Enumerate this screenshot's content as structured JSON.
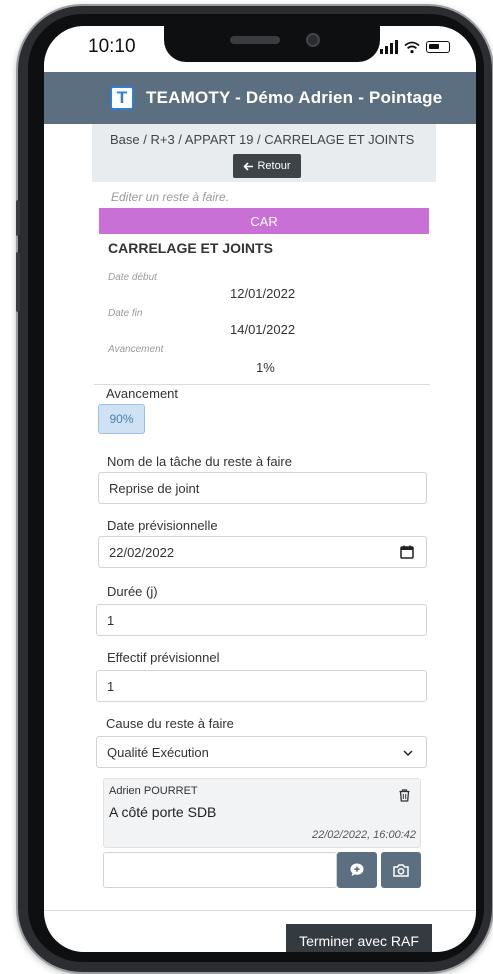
{
  "status_bar": {
    "time": "10:10"
  },
  "header": {
    "logo_letter": "T",
    "title": "TEAMOTY - Démo Adrien - Pointage",
    "bg_color": "#5c6f80"
  },
  "breadcrumb": {
    "path": "Base / R+3 / APPART 19 / CARRELAGE ET JOINTS",
    "back_label": "Retour",
    "back_icon": "arrow-left-icon"
  },
  "edit_caption": "Editer un reste à faire.",
  "task": {
    "category": "CAR",
    "category_color": "#c870d6",
    "title": "CARRELAGE ET JOINTS",
    "start_label": "Date début",
    "start_value": "12/01/2022",
    "end_label": "Date fin",
    "end_value": "14/01/2022",
    "progress_label": "Avancement",
    "progress_value": "1%"
  },
  "form": {
    "progress": {
      "label": "Avancement",
      "value": "90%"
    },
    "task_name": {
      "label": "Nom de la tâche du reste à faire",
      "value": "Reprise de joint"
    },
    "date": {
      "label": "Date prévisionnelle",
      "value": "22/02/2022",
      "icon": "calendar-icon"
    },
    "duration": {
      "label": "Durée (j)",
      "value": "1"
    },
    "staff": {
      "label": "Effectif prévisionnel",
      "value": "1"
    },
    "cause": {
      "label": "Cause du reste à faire",
      "value": "Qualité Exécution",
      "icon": "chevron-down-icon"
    }
  },
  "comment": {
    "author": "Adrien POURRET",
    "text": "A côté porte SDB",
    "date": "22/02/2022, 16:00:42",
    "delete_icon": "trash-icon"
  },
  "message_input": {
    "placeholder": "",
    "send_icon": "comment-add-icon",
    "photo_icon": "camera-icon"
  },
  "footer": {
    "finish_label": "Terminer avec RAF"
  }
}
